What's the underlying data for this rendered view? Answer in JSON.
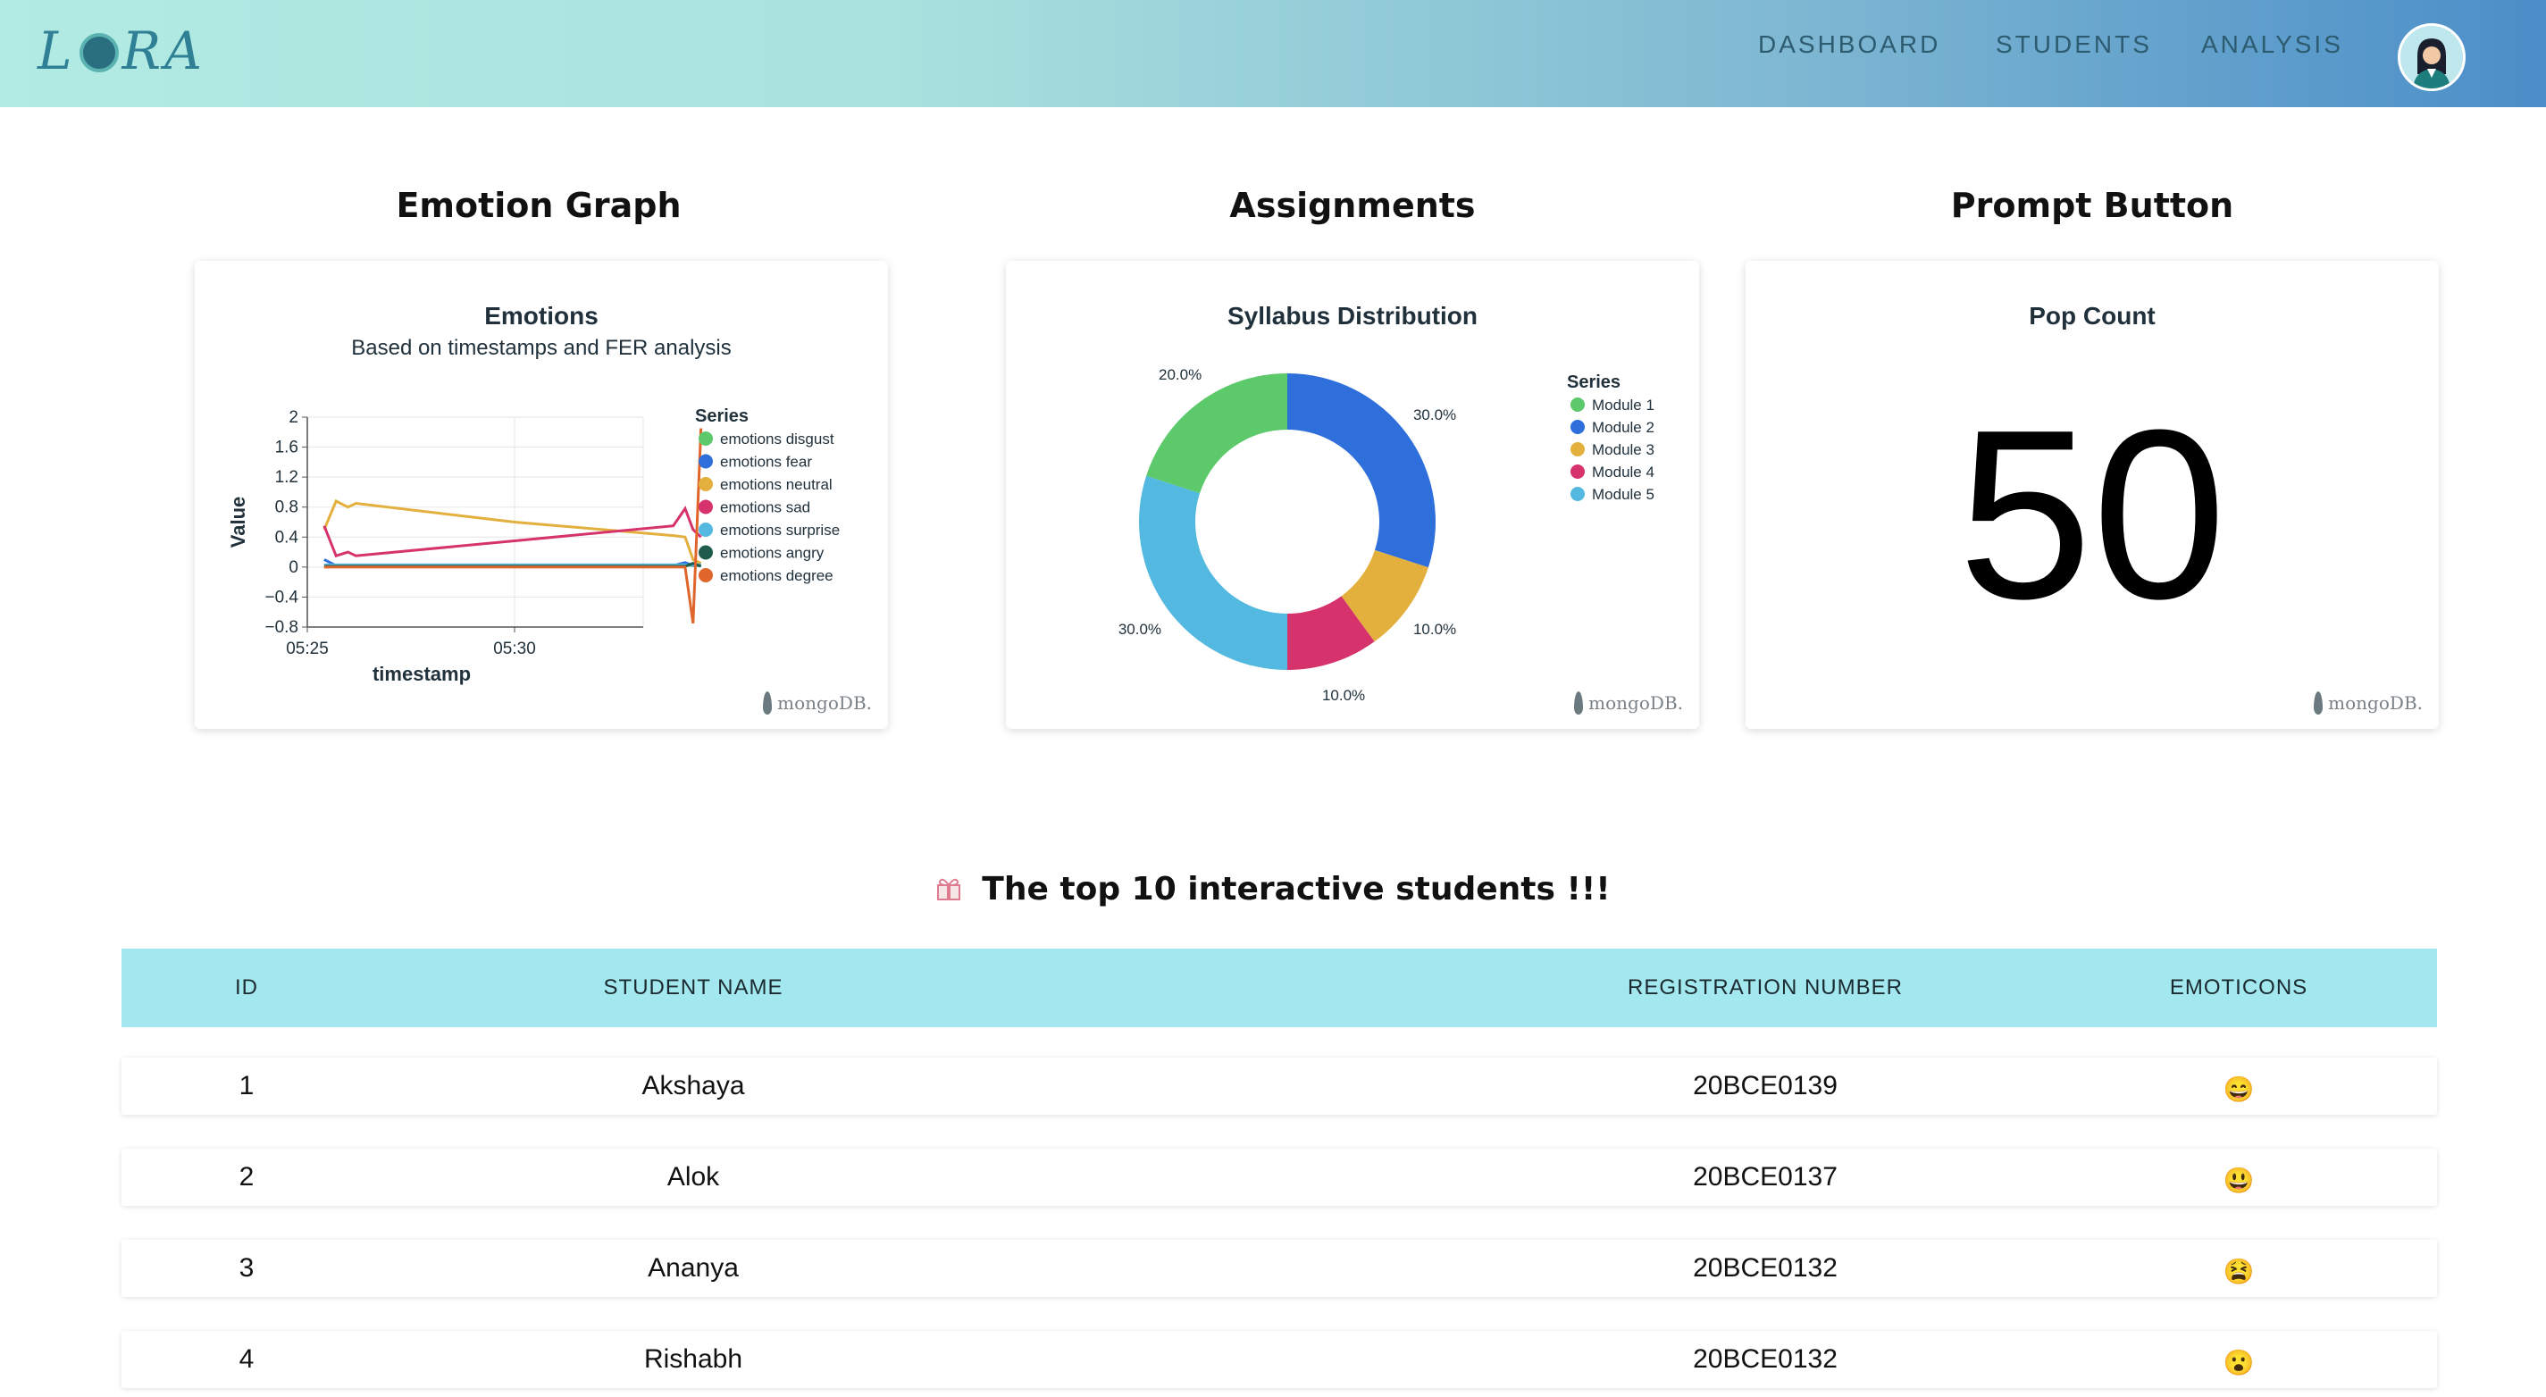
{
  "nav": {
    "logo": "LGRA",
    "links": [
      "DASHBOARD",
      "STUDENTS",
      "ANALYSIS"
    ]
  },
  "sections": {
    "emotion_title": "Emotion Graph",
    "assignments_title": "Assignments",
    "prompt_title": "Prompt Button"
  },
  "emotions_card": {
    "title": "Emotions",
    "subtitle": "Based on timestamps and FER analysis",
    "branding": "mongoDB."
  },
  "syllabus_card": {
    "title": "Syllabus Distribution",
    "branding": "mongoDB."
  },
  "popcount_card": {
    "title": "Pop Count",
    "value": "50",
    "branding": "mongoDB."
  },
  "chart_data": [
    {
      "type": "line",
      "title": "Emotions",
      "subtitle": "Based on timestamps and FER analysis",
      "xlabel": "timestamp",
      "ylabel": "Value",
      "x_ticks": [
        "05:25",
        "05:30"
      ],
      "y_ticks": [
        "2",
        "1.6",
        "1.2",
        "0.8",
        "0.4",
        "0",
        "−0.4",
        "−0.8"
      ],
      "ylim": [
        -0.8,
        2
      ],
      "grid": true,
      "legend_title": "Series",
      "legend_position": "right",
      "x": [
        "05:25.2",
        "05:25.5",
        "05:25.8",
        "05:26.0",
        "05:30.0",
        "05:34.0",
        "05:34.3",
        "05:34.5",
        "05:34.7"
      ],
      "series": [
        {
          "name": "emotions disgust",
          "color": "#5cc96b",
          "values": [
            0.02,
            0.02,
            0.02,
            0.02,
            0.02,
            0.02,
            0.02,
            0.02,
            0.02
          ]
        },
        {
          "name": "emotions fear",
          "color": "#2f6fdc",
          "values": [
            0.1,
            0.02,
            0.02,
            0.02,
            0.02,
            0.02,
            0.06,
            0.02,
            0.02
          ]
        },
        {
          "name": "emotions neutral",
          "color": "#e3b03e",
          "values": [
            0.5,
            0.88,
            0.8,
            0.85,
            0.6,
            0.42,
            0.4,
            0.1,
            0.05
          ]
        },
        {
          "name": "emotions sad",
          "color": "#d6336c",
          "values": [
            0.55,
            0.15,
            0.2,
            0.15,
            0.35,
            0.55,
            0.78,
            0.5,
            0.4
          ]
        },
        {
          "name": "emotions surprise",
          "color": "#54b9e0",
          "values": [
            0.03,
            0.03,
            0.03,
            0.03,
            0.03,
            0.03,
            0.03,
            0.03,
            0.03
          ]
        },
        {
          "name": "emotions angry",
          "color": "#1f5b4d",
          "values": [
            0.01,
            0.01,
            0.01,
            0.01,
            0.01,
            0.01,
            0.01,
            0.05,
            0.01
          ]
        },
        {
          "name": "emotions degree",
          "color": "#e0652b",
          "values": [
            0.0,
            0.0,
            0.0,
            0.0,
            0.0,
            0.0,
            0.0,
            -0.75,
            1.85
          ]
        }
      ]
    },
    {
      "type": "pie",
      "donut": true,
      "title": "Syllabus Distribution",
      "legend_title": "Series",
      "legend_position": "right",
      "slices": [
        {
          "name": "Module 1",
          "value": 20.0,
          "label": "20.0%",
          "color": "#5cc96b"
        },
        {
          "name": "Module 2",
          "value": 30.0,
          "label": "30.0%",
          "color": "#2f6fdc"
        },
        {
          "name": "Module 3",
          "value": 10.0,
          "label": "10.0%",
          "color": "#e3b03e"
        },
        {
          "name": "Module 4",
          "value": 10.0,
          "label": "10.0%",
          "color": "#d6336c"
        },
        {
          "name": "Module 5",
          "value": 30.0,
          "label": "30.0%",
          "color": "#54b9e0"
        }
      ]
    }
  ],
  "leaderboard": {
    "title": "The top 10 interactive students !!!",
    "columns": [
      "ID",
      "STUDENT NAME",
      "REGISTRATION NUMBER",
      "EMOTICONS"
    ],
    "rows": [
      {
        "id": "1",
        "name": "Akshaya",
        "reg": "20BCE0139",
        "emoticon": "😄"
      },
      {
        "id": "2",
        "name": "Alok",
        "reg": "20BCE0137",
        "emoticon": "😃"
      },
      {
        "id": "3",
        "name": "Ananya",
        "reg": "20BCE0132",
        "emoticon": "😫"
      },
      {
        "id": "4",
        "name": "Rishabh",
        "reg": "20BCE0132",
        "emoticon": "😮"
      }
    ]
  }
}
